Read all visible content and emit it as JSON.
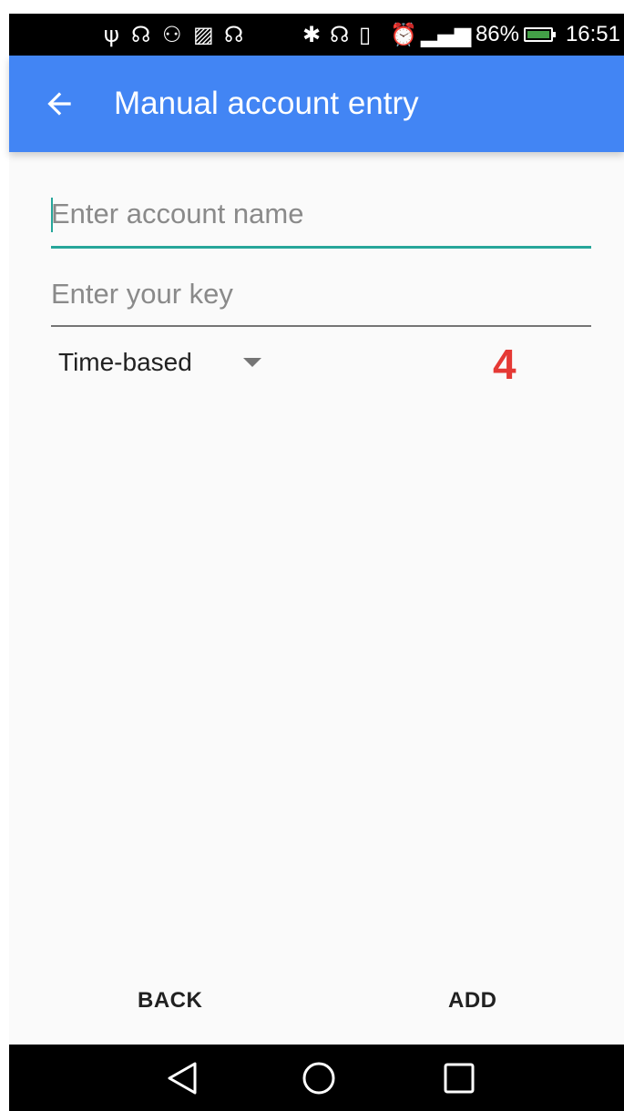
{
  "status_bar": {
    "battery_percent": "86%",
    "time": "16:51",
    "icons": [
      "usb-icon",
      "headset-icon",
      "android-debug-icon",
      "image-icon",
      "sync-headset-icon",
      "bluetooth-icon",
      "headphones-icon",
      "vibrate-icon",
      "alarm-icon",
      "signal-hplus-icon",
      "battery-charging-icon"
    ]
  },
  "app_bar": {
    "title": "Manual account entry",
    "color": "#4285f4"
  },
  "form": {
    "account_name": {
      "value": "",
      "placeholder": "Enter account name"
    },
    "key": {
      "value": "",
      "placeholder": "Enter your key"
    },
    "type_selected": "Time-based"
  },
  "annotation": "4",
  "footer": {
    "back_label": "BACK",
    "add_label": "ADD"
  },
  "nav_bar": {
    "icons": [
      "nav-back-icon",
      "nav-home-icon",
      "nav-recents-icon"
    ]
  }
}
